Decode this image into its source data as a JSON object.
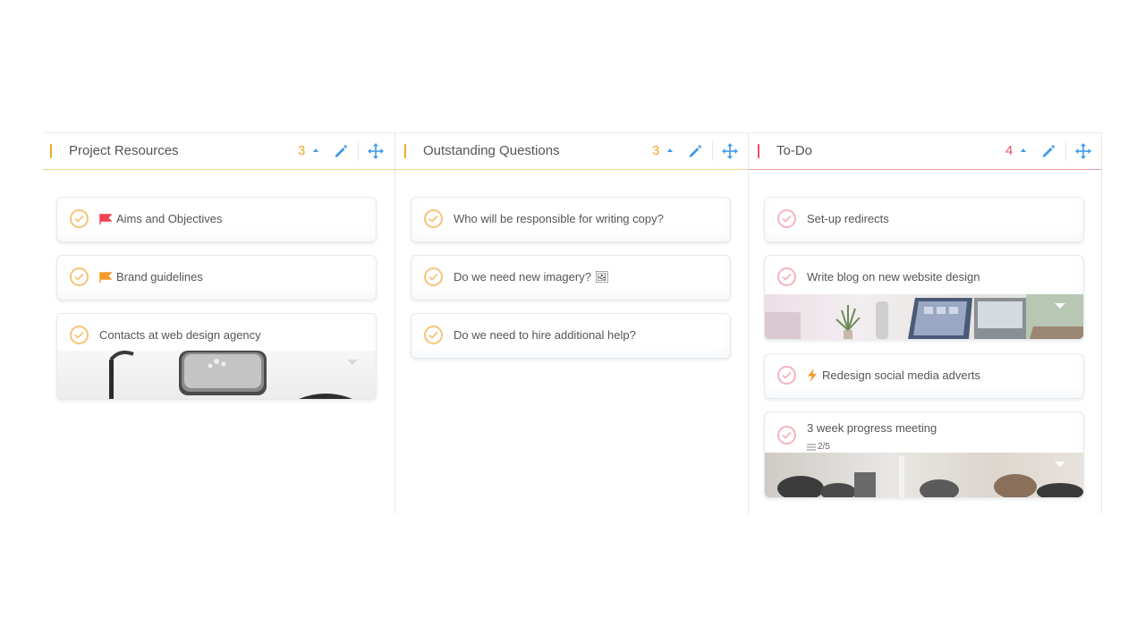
{
  "columns": [
    {
      "title": "Project Resources",
      "count": "3",
      "accent": "#f2a826",
      "line": "#f2d48a",
      "cards": [
        {
          "title": "Aims and Objectives",
          "flag": "red-flag-icon",
          "flag_color": "#f0434d"
        },
        {
          "title": "Brand guidelines",
          "flag": "orange-flag-icon",
          "flag_color": "#f29a26"
        },
        {
          "title": "Contacts at web design agency",
          "image": "headphones-and-phone-photo"
        }
      ]
    },
    {
      "title": "Outstanding Questions",
      "count": "3",
      "accent": "#f2a826",
      "line": "#f2d48a",
      "cards": [
        {
          "title": "Who will be responsible for writing copy?"
        },
        {
          "title": "Do we need new imagery? 🖼"
        },
        {
          "title": "Do we need to hire additional help?"
        }
      ]
    },
    {
      "title": "To-Do",
      "count": "4",
      "accent": "#ef4f63",
      "line": "#f19aa6",
      "cards": [
        {
          "title": "Set-up redirects"
        },
        {
          "title": "Write blog on new website design",
          "image": "desk-with-plant-photo"
        },
        {
          "title": "Redesign social media adverts",
          "icon": "lightning-bolt-icon"
        },
        {
          "title": "3 week progress meeting",
          "checklist": "2/5",
          "image": "meeting-room-photo"
        }
      ]
    }
  ],
  "colors": {
    "blue": "#3f9be8",
    "check_orange": "#f5c477",
    "check_red": "#f5b3bd"
  }
}
